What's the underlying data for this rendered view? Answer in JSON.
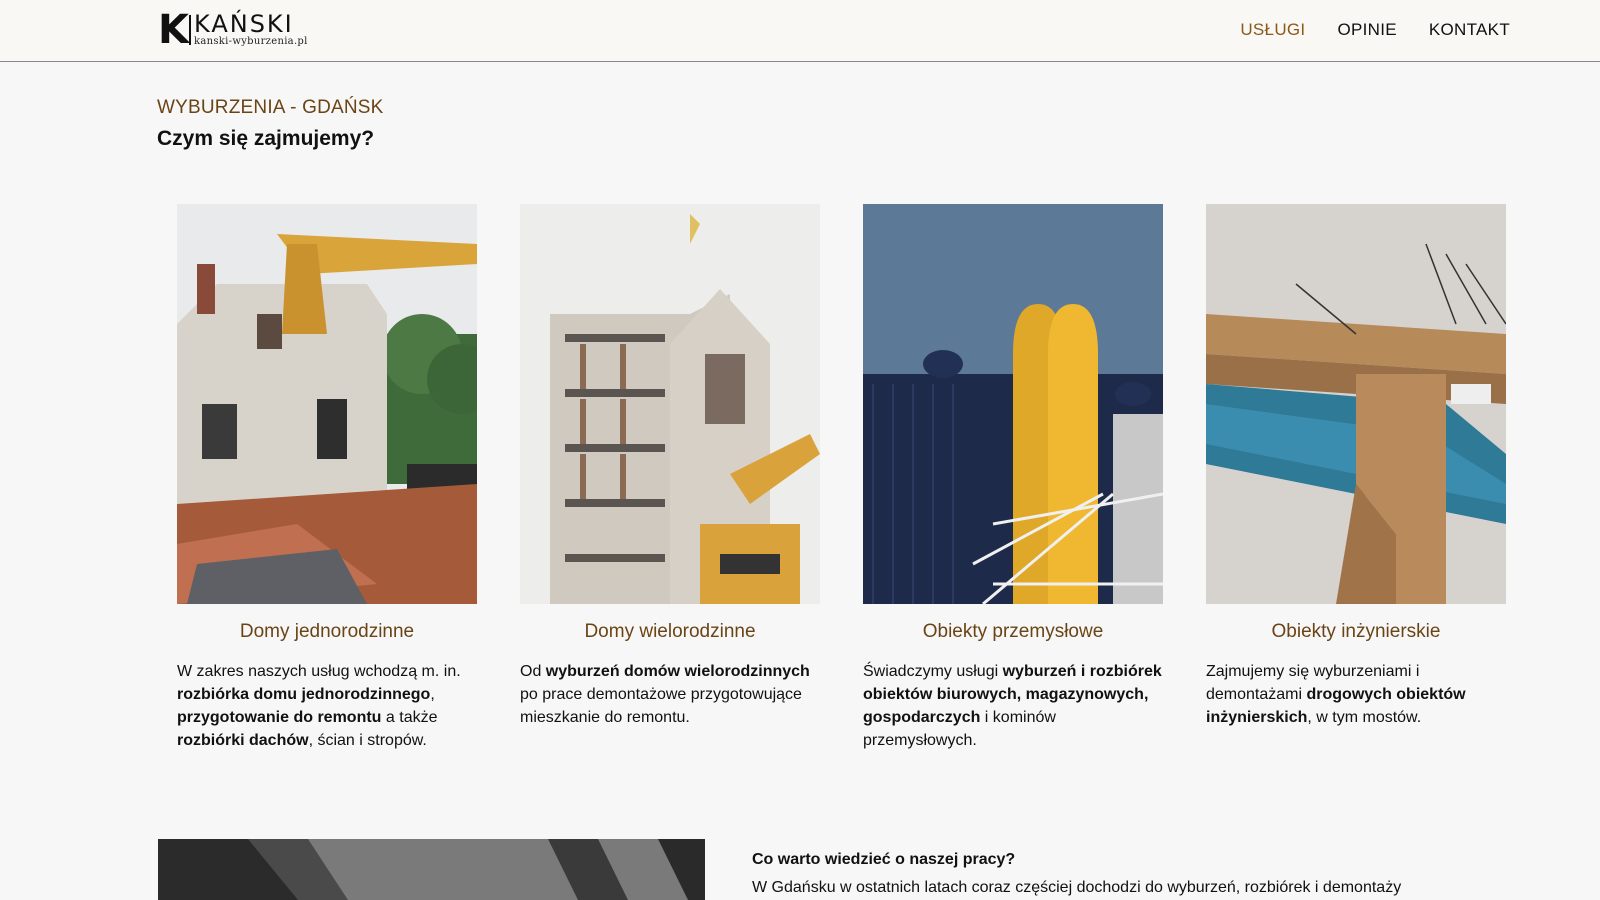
{
  "header": {
    "logo": {
      "letter": "K",
      "name": "KAŃSKI",
      "url": "kanski-wyburzenia.pl"
    },
    "nav": [
      {
        "label": "USŁUGI",
        "active": true
      },
      {
        "label": "OPINIE",
        "active": false
      },
      {
        "label": "KONTAKT",
        "active": false
      }
    ]
  },
  "section": {
    "eyebrow": "WYBURZENIA - GDAŃSK",
    "title": "Czym się zajmujemy?"
  },
  "cards": [
    {
      "title": "Domy jednorodzinne",
      "text": [
        {
          "t": "W zakres naszych usług wchodzą m. in. ",
          "b": false
        },
        {
          "t": "rozbiórka domu jednorodzinnego",
          "b": true
        },
        {
          "t": ", ",
          "b": false
        },
        {
          "t": "przygotowanie do remontu",
          "b": true
        },
        {
          "t": " a także ",
          "b": false
        },
        {
          "t": "rozbiórki dachów",
          "b": true
        },
        {
          "t": ", ścian i stropów.",
          "b": false
        }
      ]
    },
    {
      "title": "Domy wielorodzinne",
      "text": [
        {
          "t": "Od ",
          "b": false
        },
        {
          "t": "wyburzeń domów wielorodzinnych",
          "b": true
        },
        {
          "t": " po prace demontażowe przygotowujące mieszkanie do remontu.",
          "b": false
        }
      ]
    },
    {
      "title": "Obiekty przemysłowe",
      "text": [
        {
          "t": "Świadczymy usługi ",
          "b": false
        },
        {
          "t": "wyburzeń i rozbiórek obiektów biurowych, magazynowych, gospodarczych",
          "b": true
        },
        {
          "t": " i kominów przemysłowych.",
          "b": false
        }
      ]
    },
    {
      "title": "Obiekty inżynierskie",
      "text": [
        {
          "t": "Zajmujemy się wyburzeniami i demontażami ",
          "b": false
        },
        {
          "t": "drogowych obiektów inżynierskich",
          "b": true
        },
        {
          "t": ", w tym mostów.",
          "b": false
        }
      ]
    }
  ],
  "bottom": {
    "title": "Co warto wiedzieć o naszej pracy?",
    "text": "W Gdańsku w ostatnich latach coraz częściej dochodzi do wyburzeń, rozbiórek i demontaży"
  },
  "colors": {
    "accent": "#6b4416",
    "nav_active": "#8a5a1a",
    "header_bg": "#faf8f4",
    "page_bg": "#f7f7f7"
  }
}
